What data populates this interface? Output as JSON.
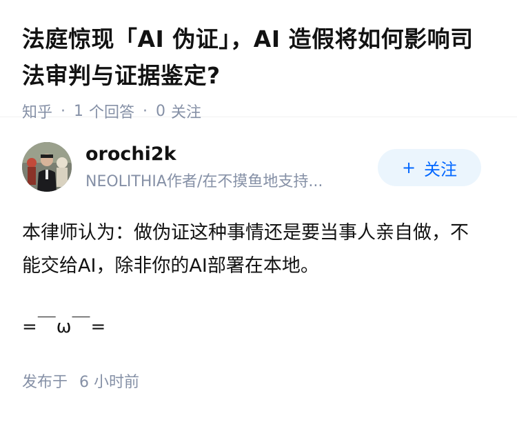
{
  "question": {
    "title": "法庭惊现「AI 伪证」，AI 造假将如何影响司法审判与证据鉴定?",
    "source": "知乎",
    "answer_count": "1",
    "answer_label": "个回答",
    "follower_count": "0",
    "follower_label": "关注"
  },
  "answer": {
    "author_name": "orochi2k",
    "author_bio": "NEOLITHIA作者/在不摸鱼地支持...",
    "follow_button_label": "关注",
    "follow_button_icon": "plus-icon",
    "content_paragraphs": [
      "本律师认为：做伪证这种事情还是要当事人亲自做，不能交给AI，除非你的AI部署在本地。",
      "=￣ω￣="
    ],
    "publish_label": "发布于",
    "publish_time": "6 小时前"
  },
  "colors": {
    "meta_gray": "#8590a6",
    "brand_blue": "#0066ff",
    "follow_bg": "#ebf5fd"
  }
}
